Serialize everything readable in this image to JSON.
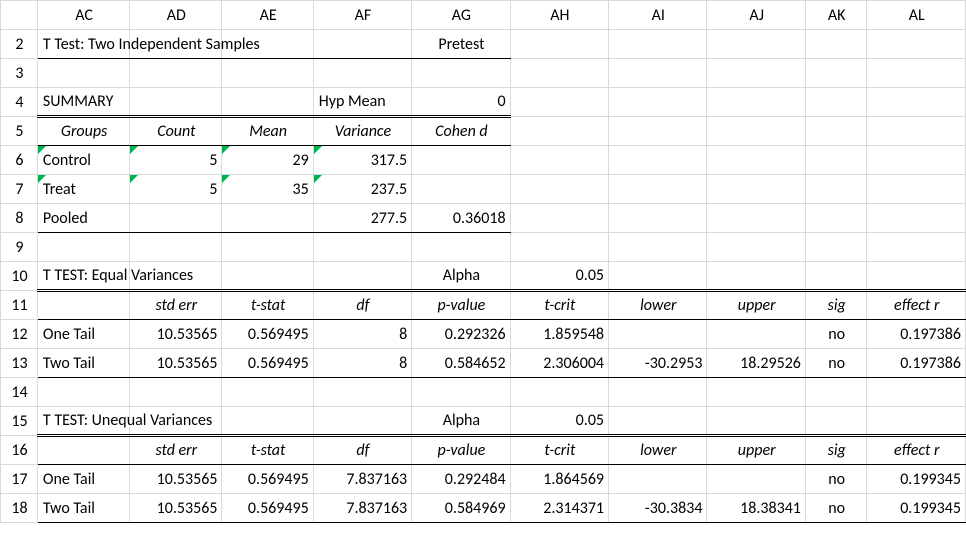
{
  "chart_data": {
    "type": "table",
    "title": "T Test: Two Independent Samples — Pretest",
    "summary": {
      "hyp_mean_label": "Hyp Mean",
      "hyp_mean": 0,
      "headers": [
        "Groups",
        "Count",
        "Mean",
        "Variance",
        "Cohen d"
      ],
      "rows": [
        {
          "group": "Control",
          "count": 5,
          "mean": 29,
          "variance": 317.5,
          "cohen_d": ""
        },
        {
          "group": "Treat",
          "count": 5,
          "mean": 35,
          "variance": 237.5,
          "cohen_d": ""
        },
        {
          "group": "Pooled",
          "count": "",
          "mean": "",
          "variance": 277.5,
          "cohen_d": 0.36018
        }
      ]
    },
    "equal_var": {
      "title": "T TEST: Equal Variances",
      "alpha_label": "Alpha",
      "alpha": 0.05,
      "headers": [
        "",
        "std err",
        "t-stat",
        "df",
        "p-value",
        "t-crit",
        "lower",
        "upper",
        "sig",
        "effect r"
      ],
      "rows": [
        {
          "tail": "One Tail",
          "std_err": 10.53565,
          "t_stat": 0.569495,
          "df": 8,
          "p_value": 0.292326,
          "t_crit": 1.859548,
          "lower": "",
          "upper": "",
          "sig": "no",
          "effect_r": 0.197386
        },
        {
          "tail": "Two Tail",
          "std_err": 10.53565,
          "t_stat": 0.569495,
          "df": 8,
          "p_value": 0.584652,
          "t_crit": 2.306004,
          "lower": -30.2953,
          "upper": 18.29526,
          "sig": "no",
          "effect_r": 0.197386
        }
      ]
    },
    "unequal_var": {
      "title": "T TEST: Unequal Variances",
      "alpha_label": "Alpha",
      "alpha": 0.05,
      "headers": [
        "",
        "std err",
        "t-stat",
        "df",
        "p-value",
        "t-crit",
        "lower",
        "upper",
        "sig",
        "effect r"
      ],
      "rows": [
        {
          "tail": "One Tail",
          "std_err": 10.53565,
          "t_stat": 0.569495,
          "df": 7.837163,
          "p_value": 0.292484,
          "t_crit": 1.864569,
          "lower": "",
          "upper": "",
          "sig": "no",
          "effect_r": 0.199345
        },
        {
          "tail": "Two Tail",
          "std_err": 10.53565,
          "t_stat": 0.569495,
          "df": 7.837163,
          "p_value": 0.584969,
          "t_crit": 2.314371,
          "lower": -30.3834,
          "upper": 18.38341,
          "sig": "no",
          "effect_r": 0.199345
        }
      ]
    }
  },
  "cols": [
    "AC",
    "AD",
    "AE",
    "AF",
    "AG",
    "AH",
    "AI",
    "AJ",
    "AK",
    "AL"
  ],
  "rows": [
    "2",
    "3",
    "4",
    "5",
    "6",
    "7",
    "8",
    "9",
    "10",
    "11",
    "12",
    "13",
    "14",
    "15",
    "16",
    "17",
    "18"
  ],
  "labels": {
    "title": "T Test: Two Independent Samples",
    "pretest": "Pretest",
    "summary_title": "SUMMARY",
    "hyp_mean_label": "Hyp Mean",
    "hyp_mean_value": "0",
    "hdr_groups": "Groups",
    "hdr_count": "Count",
    "hdr_mean": "Mean",
    "hdr_variance": "Variance",
    "hdr_cohen": "Cohen d",
    "grp_control": "Control",
    "grp_treat": "Treat",
    "grp_pooled": "Pooled",
    "eqvar_title": "T TEST: Equal Variances",
    "uneqvar_title": "T TEST: Unequal Variances",
    "alpha_label": "Alpha",
    "alpha_value": "0.05",
    "hdr_stderr": "std err",
    "hdr_tstat": "t-stat",
    "hdr_df": "df",
    "hdr_pvalue": "p-value",
    "hdr_tcrit": "t-crit",
    "hdr_lower": "lower",
    "hdr_upper": "upper",
    "hdr_sig": "sig",
    "hdr_effectr": "effect r",
    "one_tail": "One Tail",
    "two_tail": "Two Tail"
  },
  "values": {
    "control_count": "5",
    "control_mean": "29",
    "control_var": "317.5",
    "treat_count": "5",
    "treat_mean": "35",
    "treat_var": "237.5",
    "pooled_var": "277.5",
    "cohen_d": "0.36018",
    "eq_one_stderr": "10.53565",
    "eq_one_tstat": "0.569495",
    "eq_one_df": "8",
    "eq_one_pvalue": "0.292326",
    "eq_one_tcrit": "1.859548",
    "eq_one_sig": "no",
    "eq_one_effectr": "0.197386",
    "eq_two_stderr": "10.53565",
    "eq_two_tstat": "0.569495",
    "eq_two_df": "8",
    "eq_two_pvalue": "0.584652",
    "eq_two_tcrit": "2.306004",
    "eq_two_lower": "-30.2953",
    "eq_two_upper": "18.29526",
    "eq_two_sig": "no",
    "eq_two_effectr": "0.197386",
    "un_one_stderr": "10.53565",
    "un_one_tstat": "0.569495",
    "un_one_df": "7.837163",
    "un_one_pvalue": "0.292484",
    "un_one_tcrit": "1.864569",
    "un_one_sig": "no",
    "un_one_effectr": "0.199345",
    "un_two_stderr": "10.53565",
    "un_two_tstat": "0.569495",
    "un_two_df": "7.837163",
    "un_two_pvalue": "0.584969",
    "un_two_tcrit": "2.314371",
    "un_two_lower": "-30.3834",
    "un_two_upper": "18.38341",
    "un_two_sig": "no",
    "un_two_effectr": "0.199345"
  }
}
